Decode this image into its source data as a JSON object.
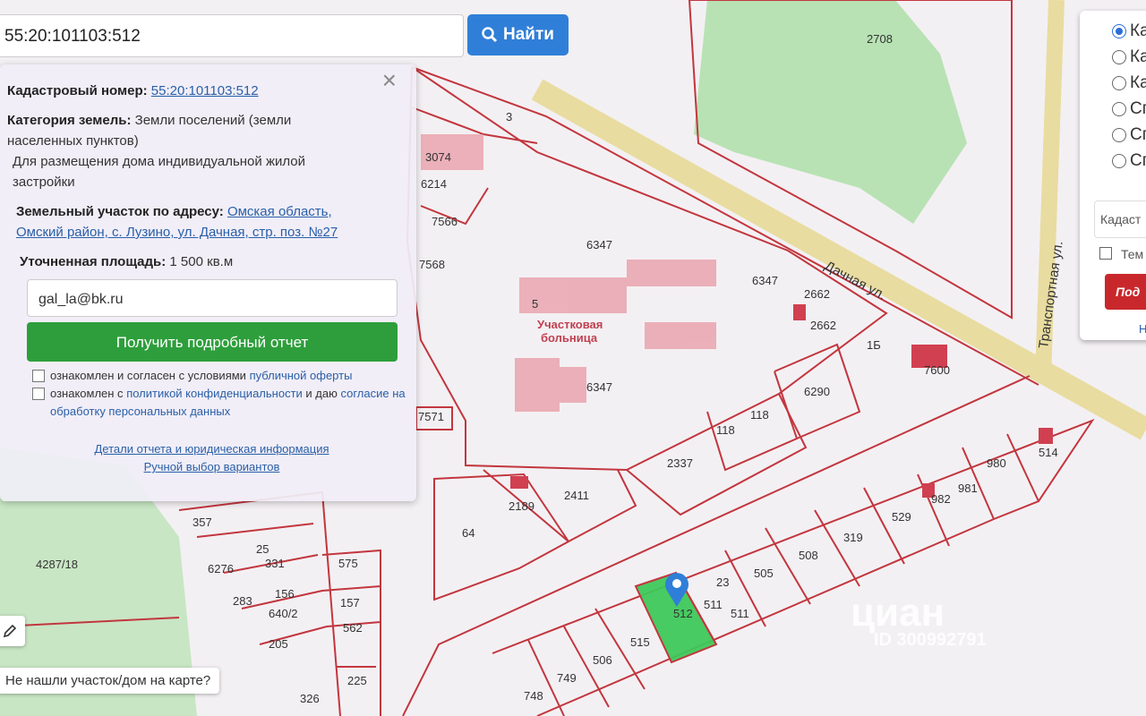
{
  "search": {
    "value": "55:20:101103:512",
    "button_label": "Найти",
    "icon": "search-icon"
  },
  "info": {
    "cad_label": "Кадастровый номер:",
    "cad_value": "55:20:101103:512",
    "cat_label": "Категория земель:",
    "cat_value": "Земли поселений (земли населенных пунктов)",
    "use": "Для размещения дома индивидуальной жилой застройки",
    "addr_label": "Земельный участок по адресу:",
    "addr_value": "Омская область, Омский район, с. Лузино, ул. Дачная, стр. поз. №27",
    "area_label": "Уточненная площадь:",
    "area_value": "1 500 кв.м",
    "email": "gal_la@bk.ru",
    "report_button": "Получить подробный отчет",
    "check1_text": "ознакомлен и согласен с условиями ",
    "check1_link": "публичной оферты",
    "check2_text": "ознакомлен с ",
    "check2_link": "политикой конфиденциальности",
    "check2_mid": " и даю ",
    "check2_link2": "согласие на обработку персональных данных",
    "link_details": "Детали отчета и юридическая информация",
    "link_manual": "Ручной выбор вариантов"
  },
  "right_panel": {
    "radios": [
      {
        "label": "Ка",
        "checked": true
      },
      {
        "label": "Ка"
      },
      {
        "label": "Ка"
      },
      {
        "label": "Сп"
      },
      {
        "label": "Сп"
      },
      {
        "label": "Сп"
      }
    ],
    "input_placeholder": "Кадаст",
    "checkbox": "Тем",
    "button": "Под",
    "link": "Н"
  },
  "map": {
    "streets": [
      "Дачная ул.",
      "Транспортная ул."
    ],
    "poi": "Участковая больница",
    "parcels": [
      "2708",
      "3074",
      "6214",
      "7566",
      "7568",
      "3",
      "6347",
      "6347",
      "6347",
      "5",
      "2662",
      "2662",
      "1Б",
      "7600",
      "6290",
      "118",
      "118",
      "2337",
      "7571",
      "2411",
      "2189",
      "64",
      "514",
      "980",
      "981",
      "982",
      "529",
      "319",
      "508",
      "505",
      "511",
      "511",
      "23",
      "512",
      "515",
      "506",
      "749",
      "748",
      "357",
      "6276",
      "25",
      "331",
      "575",
      "156",
      "640/2",
      "157",
      "562",
      "283",
      "205",
      "225",
      "326",
      "4287/18"
    ],
    "selected_parcel_color": "#3ec85a"
  },
  "watermark": {
    "brand": "циан",
    "id": "ID 300992791"
  },
  "not_found": "Не нашли участок/дом на карте?"
}
